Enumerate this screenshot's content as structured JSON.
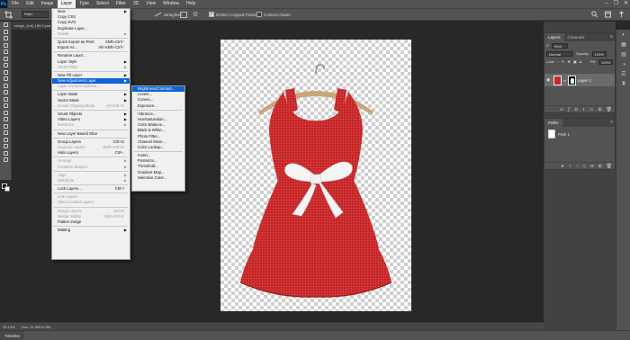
{
  "menubar": {
    "logo": "Ps",
    "items": [
      "File",
      "Edit",
      "Image",
      "Layer",
      "Type",
      "Select",
      "Filter",
      "3D",
      "View",
      "Window",
      "Help"
    ],
    "active_index": 3,
    "window_controls": [
      "–",
      "❐",
      "✕"
    ]
  },
  "options": {
    "ratio": "Ratio",
    "straighten": "Straighten",
    "delete_cropped": "Delete Cropped Pixels",
    "content_aware": "Content-Aware"
  },
  "document_tab": "image_1mil_189.2.psd",
  "status": {
    "zoom": "25.13%",
    "doc": "Doc: 11.9M/10.0M"
  },
  "timeline_tab": "Timeline",
  "layers_panel": {
    "tabs": [
      "Layers",
      "Channels"
    ],
    "kind": "Kind",
    "blend": "Normal",
    "opacity_label": "Opacity:",
    "opacity": "100%",
    "lock_label": "Lock:",
    "fill_label": "Fill:",
    "fill": "100%",
    "layer_name": "Layer 1"
  },
  "paths_panel": {
    "tab": "Paths",
    "path_name": "Path 1"
  },
  "layer_menu": [
    {
      "label": "New",
      "arrow": true
    },
    {
      "label": "Copy CSS"
    },
    {
      "label": "Copy SVG"
    },
    {
      "label": "Duplicate Layer..."
    },
    {
      "label": "Delete",
      "arrow": true,
      "disabled": true
    },
    {
      "sep": true
    },
    {
      "label": "Quick Export as PNG",
      "shortcut": "Shift+Ctrl+'"
    },
    {
      "label": "Export As...",
      "shortcut": "Alt+Shift+Ctrl+'"
    },
    {
      "sep": true
    },
    {
      "label": "Rename Layer..."
    },
    {
      "label": "Layer Style",
      "arrow": true
    },
    {
      "label": "Smart Filter",
      "arrow": true,
      "disabled": true
    },
    {
      "sep": true
    },
    {
      "label": "New Fill Layer",
      "arrow": true
    },
    {
      "label": "New Adjustment Layer",
      "arrow": true,
      "highlight": true
    },
    {
      "label": "Layer Content Options...",
      "disabled": true
    },
    {
      "sep": true
    },
    {
      "label": "Layer Mask",
      "arrow": true
    },
    {
      "label": "Vector Mask",
      "arrow": true
    },
    {
      "label": "Create Clipping Mask",
      "shortcut": "Alt+Ctrl+G",
      "disabled": true
    },
    {
      "sep": true
    },
    {
      "label": "Smart Objects",
      "arrow": true
    },
    {
      "label": "Video Layers",
      "arrow": true
    },
    {
      "label": "Rasterize",
      "arrow": true,
      "disabled": true
    },
    {
      "sep": true
    },
    {
      "label": "New Layer Based Slice"
    },
    {
      "sep": true
    },
    {
      "label": "Group Layers",
      "shortcut": "Ctrl+G"
    },
    {
      "label": "Ungroup Layers",
      "shortcut": "Shift+Ctrl+G",
      "disabled": true
    },
    {
      "label": "Hide Layers",
      "shortcut": "Ctrl+,"
    },
    {
      "sep": true
    },
    {
      "label": "Arrange",
      "arrow": true,
      "disabled": true
    },
    {
      "label": "Combine Shapes",
      "arrow": true,
      "disabled": true
    },
    {
      "sep": true
    },
    {
      "label": "Align",
      "arrow": true,
      "disabled": true
    },
    {
      "label": "Distribute",
      "arrow": true,
      "disabled": true
    },
    {
      "sep": true
    },
    {
      "label": "Lock Layers...",
      "shortcut": "Ctrl+/"
    },
    {
      "sep": true
    },
    {
      "label": "Link Layers",
      "disabled": true
    },
    {
      "label": "Select Linked Layers",
      "disabled": true
    },
    {
      "sep": true
    },
    {
      "label": "Merge Layers",
      "shortcut": "Ctrl+E",
      "disabled": true
    },
    {
      "label": "Merge Visible",
      "shortcut": "Shift+Ctrl+E",
      "disabled": true
    },
    {
      "label": "Flatten Image"
    },
    {
      "sep": true
    },
    {
      "label": "Matting",
      "arrow": true
    }
  ],
  "adjustment_submenu": [
    {
      "label": "Brightness/Contrast...",
      "highlight": true
    },
    {
      "label": "Levels..."
    },
    {
      "label": "Curves..."
    },
    {
      "label": "Exposure..."
    },
    {
      "sep": true
    },
    {
      "label": "Vibrance..."
    },
    {
      "label": "Hue/Saturation..."
    },
    {
      "label": "Color Balance..."
    },
    {
      "label": "Black & White..."
    },
    {
      "label": "Photo Filter..."
    },
    {
      "label": "Channel Mixer..."
    },
    {
      "label": "Color Lookup..."
    },
    {
      "sep": true
    },
    {
      "label": "Invert..."
    },
    {
      "label": "Posterize..."
    },
    {
      "label": "Threshold..."
    },
    {
      "label": "Gradient Map..."
    },
    {
      "label": "Selective Color..."
    }
  ],
  "colors": {
    "menu_highlight": "#0a64d6",
    "dress_red": "#c8282a",
    "bow_white": "#f4f4f4",
    "hanger_wood": "#c9a57a"
  }
}
